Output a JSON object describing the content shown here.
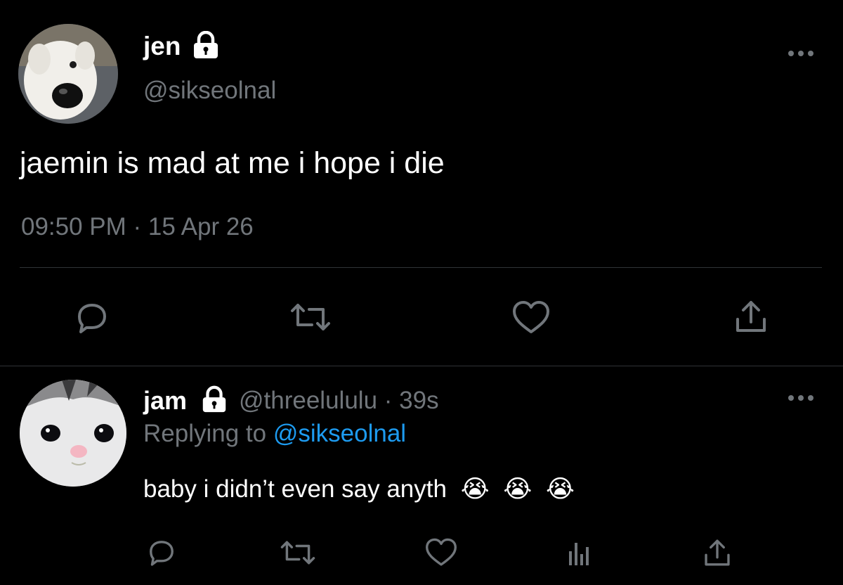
{
  "main_tweet": {
    "display_name": "jen",
    "handle": "@sikseolnal",
    "text": "jaemin is mad at me i hope i die",
    "timestamp": "09:50 PM · 15 Apr 26",
    "avatar_icon": "samoyed-dog-avatar",
    "locked": true
  },
  "reply": {
    "display_name": "jam",
    "handle": "@threelululu",
    "separator": "·",
    "time_ago": "39s",
    "replying_prefix": "Replying to",
    "replying_to": "@sikseolnal",
    "text": "baby i didn’t even say anyth",
    "emojis": [
      "😭",
      "😭",
      "😭"
    ],
    "avatar_icon": "kitten-avatar",
    "locked": true
  },
  "colors": {
    "background": "#000000",
    "text": "#e7e9ea",
    "muted": "#71767b",
    "link": "#1d9bf0",
    "divider": "#2f3336"
  }
}
